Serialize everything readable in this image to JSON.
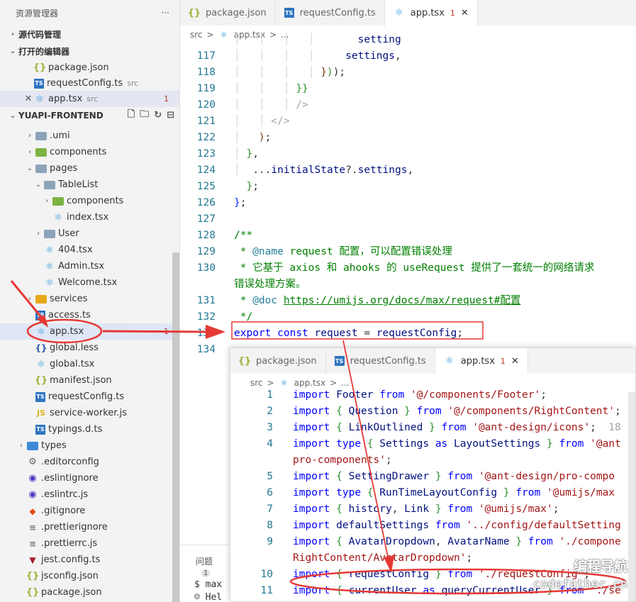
{
  "sidebar": {
    "title": "资源管理器",
    "more_icon": "ellipsis-icon",
    "source_control": "源代码管理",
    "open_editors": {
      "title": "打开的编辑器",
      "items": [
        {
          "name": "package.json",
          "desc": "",
          "badge": "",
          "icon": "json-icon"
        },
        {
          "name": "requestConfig.ts",
          "desc": "src",
          "badge": "",
          "icon": "ts-icon"
        },
        {
          "name": "app.tsx",
          "desc": "src",
          "badge": "1",
          "icon": "react-icon"
        }
      ]
    },
    "project": {
      "title": "YUAPI-FRONTEND",
      "tree": [
        {
          "name": ".umi",
          "indent": 1,
          "chevron": ">",
          "icon": "folder"
        },
        {
          "name": "components",
          "indent": 1,
          "chevron": ">",
          "icon": "folder-green"
        },
        {
          "name": "pages",
          "indent": 1,
          "chevron": "v",
          "icon": "folder"
        },
        {
          "name": "TableList",
          "indent": 2,
          "chevron": "v",
          "icon": "folder"
        },
        {
          "name": "components",
          "indent": 3,
          "chevron": ">",
          "icon": "folder-green"
        },
        {
          "name": "index.tsx",
          "indent": 3,
          "chevron": "",
          "icon": "react"
        },
        {
          "name": "User",
          "indent": 2,
          "chevron": ">",
          "icon": "folder"
        },
        {
          "name": "404.tsx",
          "indent": 2,
          "chevron": "",
          "icon": "react"
        },
        {
          "name": "Admin.tsx",
          "indent": 2,
          "chevron": "",
          "icon": "react"
        },
        {
          "name": "Welcome.tsx",
          "indent": 2,
          "chevron": "",
          "icon": "react"
        },
        {
          "name": "services",
          "indent": 1,
          "chevron": ">",
          "icon": "folder-yellow"
        },
        {
          "name": "access.ts",
          "indent": 1,
          "chevron": "",
          "icon": "ts"
        },
        {
          "name": "app.tsx",
          "indent": 1,
          "chevron": "",
          "icon": "react",
          "badge": "1",
          "selected": true
        },
        {
          "name": "global.less",
          "indent": 1,
          "chevron": "",
          "icon": "less"
        },
        {
          "name": "global.tsx",
          "indent": 1,
          "chevron": "",
          "icon": "react"
        },
        {
          "name": "manifest.json",
          "indent": 1,
          "chevron": "",
          "icon": "json"
        },
        {
          "name": "requestConfig.ts",
          "indent": 1,
          "chevron": "",
          "icon": "ts"
        },
        {
          "name": "service-worker.js",
          "indent": 1,
          "chevron": "",
          "icon": "js"
        },
        {
          "name": "typings.d.ts",
          "indent": 1,
          "chevron": "",
          "icon": "ts"
        },
        {
          "name": "types",
          "indent": 0,
          "chevron": ">",
          "icon": "folder-blue"
        },
        {
          "name": ".editorconfig",
          "indent": 0,
          "chevron": "",
          "icon": "gear"
        },
        {
          "name": ".eslintignore",
          "indent": 0,
          "chevron": "",
          "icon": "eslint"
        },
        {
          "name": ".eslintrc.js",
          "indent": 0,
          "chevron": "",
          "icon": "eslint"
        },
        {
          "name": ".gitignore",
          "indent": 0,
          "chevron": "",
          "icon": "git"
        },
        {
          "name": ".prettierignore",
          "indent": 0,
          "chevron": "",
          "icon": "lines"
        },
        {
          "name": ".prettierrc.js",
          "indent": 0,
          "chevron": "",
          "icon": "lines"
        },
        {
          "name": "jest.config.ts",
          "indent": 0,
          "chevron": "",
          "icon": "jest"
        },
        {
          "name": "jsconfig.json",
          "indent": 0,
          "chevron": "",
          "icon": "json"
        },
        {
          "name": "package.json",
          "indent": 0,
          "chevron": "",
          "icon": "json"
        }
      ]
    }
  },
  "editor": {
    "tabs": [
      {
        "name": "package.json",
        "icon": "json-icon",
        "badge": "",
        "active": false
      },
      {
        "name": "requestConfig.ts",
        "icon": "ts-icon",
        "badge": "",
        "active": false
      },
      {
        "name": "app.tsx",
        "icon": "react-icon",
        "badge": "1",
        "active": true
      }
    ],
    "breadcrumb": [
      "src",
      ">",
      "app.tsx",
      ">",
      "..."
    ],
    "lines": [
      {
        "n": "",
        "html": "<span class='ind'>│   │   │   │   </span>    <span class='id'>setting</span>"
      },
      {
        "n": "117",
        "html": "<span class='ind'>│   │   │   │   </span>  <span class='id'>settings</span>,"
      },
      {
        "n": "118",
        "html": "<span class='ind'>│   │   │   │ </span><span class='br3'>}</span><span class='br2'>)</span>);"
      },
      {
        "n": "119",
        "html": "<span class='ind'>│   │   │ </span><span class='br2'>}}</span>"
      },
      {
        "n": "120",
        "html": "<span class='ind'>│   │   │ </span><span class='brk'>/&gt;</span>"
      },
      {
        "n": "121",
        "html": "<span class='ind'>│   │ </span><span class='brk'>&lt;/&gt;</span>"
      },
      {
        "n": "122",
        "html": "<span class='ind'>│   </span><span class='br3'>)</span>;"
      },
      {
        "n": "123",
        "html": "<span class='ind'>│ </span><span class='br2'>}</span>,"
      },
      {
        "n": "124",
        "html": "<span class='ind'>│ </span> ...<span class='id'>initialState</span>?.<span class='id'>settings</span>,"
      },
      {
        "n": "125",
        "html": "  <span class='br2'>}</span>;"
      },
      {
        "n": "126",
        "html": "<span class='br1'>}</span>;"
      },
      {
        "n": "127",
        "html": ""
      },
      {
        "n": "128",
        "html": "<span class='cm'>/**</span>"
      },
      {
        "n": "129",
        "html": "<span class='cm'> * </span><span class='cm-kw'>@name</span><span class='cm'> request 配置，可以配置错误处理</span>"
      },
      {
        "n": "130",
        "html": "<span class='cm'> * 它基于 axios 和 ahooks 的 useRequest 提供了一套统一的网络请求</span>"
      },
      {
        "n": "",
        "html": "<span class='cm'>错误处理方案。</span>"
      },
      {
        "n": "131",
        "html": "<span class='cm'> * </span><span class='cm-kw'>@doc</span><span class='cm'> </span><span class='lnk'>https://umijs.org/docs/max/request#配置</span>"
      },
      {
        "n": "132",
        "html": "<span class='cm'> */</span>"
      },
      {
        "n": "133",
        "html": "<span class='kw'>export</span> <span class='kw'>const</span> <span class='id'>request</span> = <span class='id'>requestConfig</span>;"
      },
      {
        "n": "134",
        "html": ""
      }
    ],
    "panel_tab": "问题",
    "panel_badge": "1",
    "terminal_lines": [
      "$ max",
      "Hel"
    ]
  },
  "overlay": {
    "tabs": [
      {
        "name": "package.json",
        "icon": "json-icon",
        "badge": "",
        "active": false
      },
      {
        "name": "requestConfig.ts",
        "icon": "ts-icon",
        "badge": "",
        "active": false
      },
      {
        "name": "app.tsx",
        "icon": "react-icon",
        "badge": "1",
        "active": true
      }
    ],
    "breadcrumb": [
      "src",
      ">",
      "app.tsx",
      ">",
      "..."
    ],
    "lines": [
      {
        "n": "1",
        "html": "<span class='kw'>import</span> <span class='id'>Footer</span> <span class='kw'>from</span> <span class='str'>'@/components/Footer'</span>;"
      },
      {
        "n": "2",
        "html": "<span class='kw'>import</span> <span class='br2'>{</span> <span class='id'>Question</span> <span class='br2'>}</span> <span class='kw'>from</span> <span class='str'>'@/components/RightContent'</span>;"
      },
      {
        "n": "3",
        "html": "<span class='kw'>import</span> <span class='br2'>{</span> <span class='id'>LinkOutlined</span> <span class='br2'>}</span> <span class='kw'>from</span> <span class='str'>'@ant-design/icons'</span>;  <span class='brk'>18</span>"
      },
      {
        "n": "4",
        "html": "<span class='kw'>import</span> <span class='kw'>type</span> <span class='br2'>{</span> <span class='id'>Settings</span> <span class='kw'>as</span> <span class='id'>LayoutSettings</span> <span class='br2'>}</span> <span class='kw'>from</span> <span class='str'>'@ant</span>"
      },
      {
        "n": "",
        "html": "<span class='str'>pro-components'</span>;"
      },
      {
        "n": "5",
        "html": "<span class='kw'>import</span> <span class='br2'>{</span> <span class='id'>SettingDrawer</span> <span class='br2'>}</span> <span class='kw'>from</span> <span class='str'>'@ant-design/pro-compo</span>"
      },
      {
        "n": "6",
        "html": "<span class='kw'>import</span> <span class='kw'>type</span> <span class='br2'>{</span> <span class='id'>RunTimeLayoutConfig</span> <span class='br2'>}</span> <span class='kw'>from</span> <span class='str'>'@umijs/max</span>"
      },
      {
        "n": "7",
        "html": "<span class='kw'>import</span> <span class='br2'>{</span> <span class='id'>history</span>, <span class='id'>Link</span> <span class='br2'>}</span> <span class='kw'>from</span> <span class='str'>'@umijs/max'</span>;"
      },
      {
        "n": "8",
        "html": "<span class='kw'>import</span> <span class='id'>defaultSettings</span> <span class='kw'>from</span> <span class='str'>'../config/defaultSetting</span>"
      },
      {
        "n": "9",
        "html": "<span class='kw'>import</span> <span class='br2'>{</span> <span class='id'>AvatarDropdown</span>, <span class='id'>AvatarName</span> <span class='br2'>}</span> <span class='kw'>from</span> <span class='str'>'./compone</span>"
      },
      {
        "n": "",
        "html": "<span class='str'>RightContent/AvatarDropdown'</span>;"
      },
      {
        "n": "10",
        "html": "<span class='kw'>import</span> <span class='br2'>{</span> <span class='id'>requestConfig</span> <span class='br2'>}</span> <span class='kw'>from</span> <span class='str'>'./requestConfig'</span>;"
      },
      {
        "n": "11",
        "html": "<span class='kw'>import</span> <span class='br2'>{</span> <span class='id'>currentUser</span> <span class='kw'>as</span> <span class='id'>queryCurrentUser</span> <span class='br2'>}</span> <span class='kw'>from</span> <span class='str'>'./se</span>"
      }
    ]
  },
  "watermark": {
    "line1": "编程导航",
    "line2": "codefather.cn"
  },
  "colors": {
    "annotation": "#e53935",
    "selection": "#dfe6f5",
    "sidebar_bg": "#f3f3f3"
  }
}
